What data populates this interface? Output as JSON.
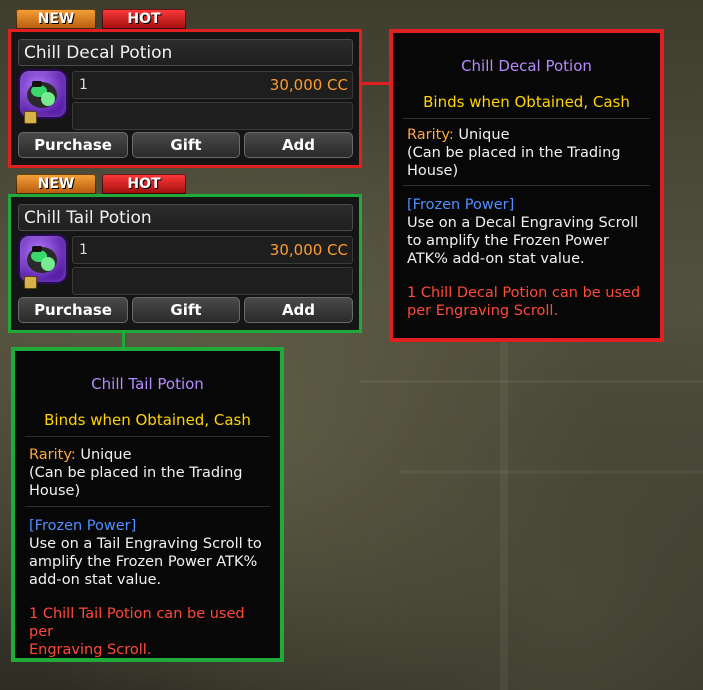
{
  "tags": {
    "new": "NEW",
    "hot": "HOT"
  },
  "items": [
    {
      "name": "Chill Decal Potion",
      "quantity": "1",
      "price": "30,000 CC",
      "buttons": {
        "purchase": "Purchase",
        "gift": "Gift",
        "add": "Add"
      }
    },
    {
      "name": "Chill Tail Potion",
      "quantity": "1",
      "price": "30,000 CC",
      "buttons": {
        "purchase": "Purchase",
        "gift": "Gift",
        "add": "Add"
      }
    }
  ],
  "tooltips": [
    {
      "title": "Chill Decal Potion",
      "binds": "Binds when Obtained, Cash",
      "rarity_label": "Rarity:",
      "rarity_value": "Unique",
      "trade_line1": "(Can be placed in the Trading",
      "trade_line2": "House)",
      "power_title": "[Frozen Power]",
      "power_line1": "Use on a Decal Engraving Scroll",
      "power_line2": "to amplify the Frozen Power",
      "power_line3": "ATK% add-on stat value.",
      "limit_line1": "1 Chill Decal Potion can be used",
      "limit_line2": "per Engraving Scroll."
    },
    {
      "title": "Chill Tail Potion",
      "binds": "Binds when Obtained, Cash",
      "rarity_label": "Rarity:",
      "rarity_value": "Unique",
      "trade_line1": "(Can be placed in the Trading",
      "trade_line2": "House)",
      "power_title": "[Frozen Power]",
      "power_line1": "Use on a Tail Engraving Scroll to",
      "power_line2": "amplify the Frozen Power ATK%",
      "power_line3": "add-on stat value.",
      "limit_line1": "1 Chill Tail Potion can be used per",
      "limit_line2": "Engraving Scroll."
    }
  ],
  "colors": {
    "highlight_red": "#e02020",
    "highlight_green": "#1faa3a",
    "price": "#ff9c2e",
    "tooltip_title": "#b58cff",
    "binds": "#ffd400",
    "rarity": "#ffa640",
    "power": "#4f8fff",
    "limit": "#ff4a3a"
  },
  "icons": [
    "potion-icon",
    "lock-icon"
  ]
}
